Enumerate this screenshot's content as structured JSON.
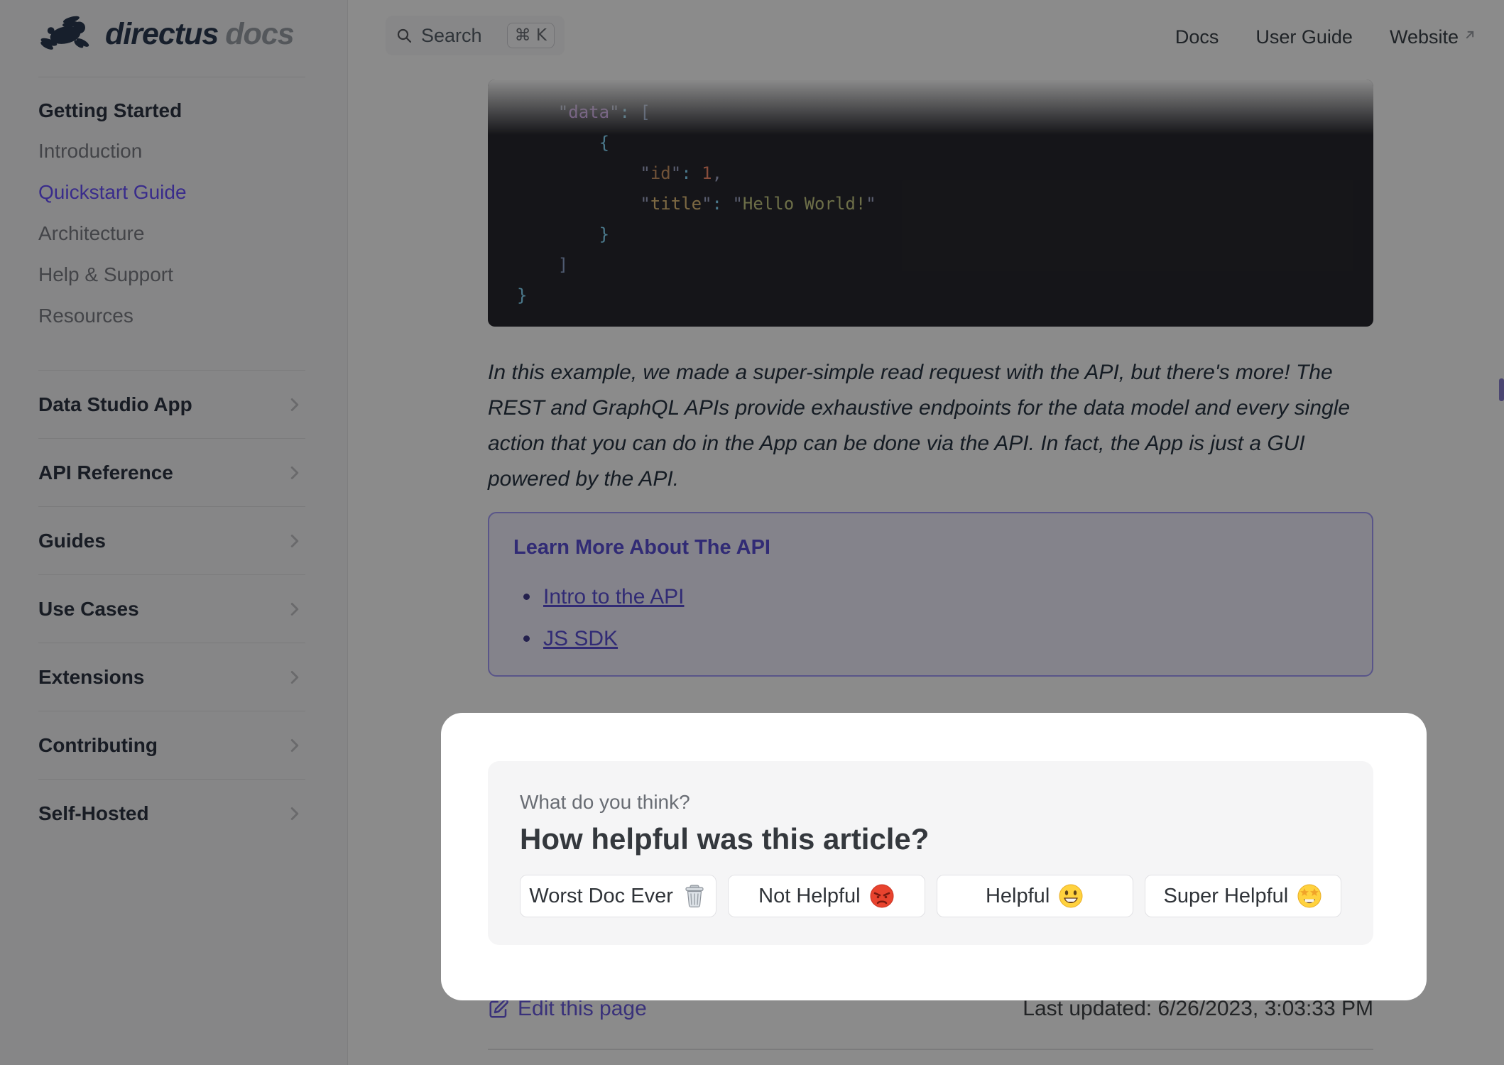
{
  "brand": {
    "name": "directus",
    "suffix": "docs"
  },
  "topnav": {
    "search_label": "Search",
    "search_shortcut": "⌘ K",
    "links": [
      {
        "label": "Docs",
        "external": false
      },
      {
        "label": "User Guide",
        "external": false
      },
      {
        "label": "Website",
        "external": true
      }
    ]
  },
  "sidebar": {
    "section": {
      "header": "Getting Started",
      "items": [
        {
          "label": "Introduction",
          "active": false
        },
        {
          "label": "Quickstart Guide",
          "active": true
        },
        {
          "label": "Architecture",
          "active": false
        },
        {
          "label": "Help & Support",
          "active": false
        },
        {
          "label": "Resources",
          "active": false
        }
      ]
    },
    "groups": [
      {
        "label": "Data Studio App"
      },
      {
        "label": "API Reference"
      },
      {
        "label": "Guides"
      },
      {
        "label": "Use Cases"
      },
      {
        "label": "Extensions"
      },
      {
        "label": "Contributing"
      },
      {
        "label": "Self-Hosted"
      }
    ]
  },
  "content": {
    "code": {
      "lines": [
        [
          {
            "t": "    ",
            "c": "pl"
          },
          {
            "t": "\"",
            "c": "qt"
          },
          {
            "t": "data",
            "c": "k1"
          },
          {
            "t": "\"",
            "c": "qt"
          },
          {
            "t": ": ",
            "c": "pu"
          },
          {
            "t": "[",
            "c": "sq"
          }
        ],
        [
          {
            "t": "        ",
            "c": "pl"
          },
          {
            "t": "{",
            "c": "pu"
          }
        ],
        [
          {
            "t": "            ",
            "c": "pl"
          },
          {
            "t": "\"",
            "c": "qt"
          },
          {
            "t": "id",
            "c": "k2"
          },
          {
            "t": "\"",
            "c": "qt"
          },
          {
            "t": ": ",
            "c": "pu"
          },
          {
            "t": "1",
            "c": "num"
          },
          {
            "t": ",",
            "c": "qt"
          }
        ],
        [
          {
            "t": "            ",
            "c": "pl"
          },
          {
            "t": "\"",
            "c": "qt"
          },
          {
            "t": "title",
            "c": "k3"
          },
          {
            "t": "\"",
            "c": "qt"
          },
          {
            "t": ": ",
            "c": "pu"
          },
          {
            "t": "\"",
            "c": "qt"
          },
          {
            "t": "Hello World!",
            "c": "str"
          },
          {
            "t": "\"",
            "c": "qt"
          }
        ],
        [
          {
            "t": "        ",
            "c": "pl"
          },
          {
            "t": "}",
            "c": "pu"
          }
        ],
        [
          {
            "t": "    ",
            "c": "pl"
          },
          {
            "t": "]",
            "c": "sq"
          }
        ],
        [
          {
            "t": "}",
            "c": "pu"
          }
        ]
      ]
    },
    "paragraph_lines": [
      "In this example, we made a super-simple read request with the API, but there's more! The",
      "REST and GraphQL APIs provide exhaustive endpoints for the data model and every single",
      "action that you can do in the App can be done via the API. In fact, the App is just a GUI",
      "powered by the API."
    ],
    "info_box": {
      "title": "Learn More About The API",
      "links": [
        {
          "label": "Intro to the API"
        },
        {
          "label": "JS SDK"
        }
      ]
    }
  },
  "feedback": {
    "kicker": "What do you think?",
    "title": "How helpful was this article?",
    "buttons": [
      {
        "label": "Worst Doc Ever",
        "emoji": "🗑️"
      },
      {
        "label": "Not Helpful",
        "emoji": "😡"
      },
      {
        "label": "Helpful",
        "emoji": "😃"
      },
      {
        "label": "Super Helpful",
        "emoji": "🤩"
      }
    ]
  },
  "footer": {
    "edit_link": "Edit this page",
    "last_updated": "Last updated: 6/26/2023, 3:03:33 PM"
  },
  "colors": {
    "accent": "#6951ff",
    "info_box_bg": "#f2f0ff",
    "info_box_border": "#a49dfb",
    "code_bg": "#28282e",
    "overlay": "rgba(0,0,0,0.455)"
  }
}
